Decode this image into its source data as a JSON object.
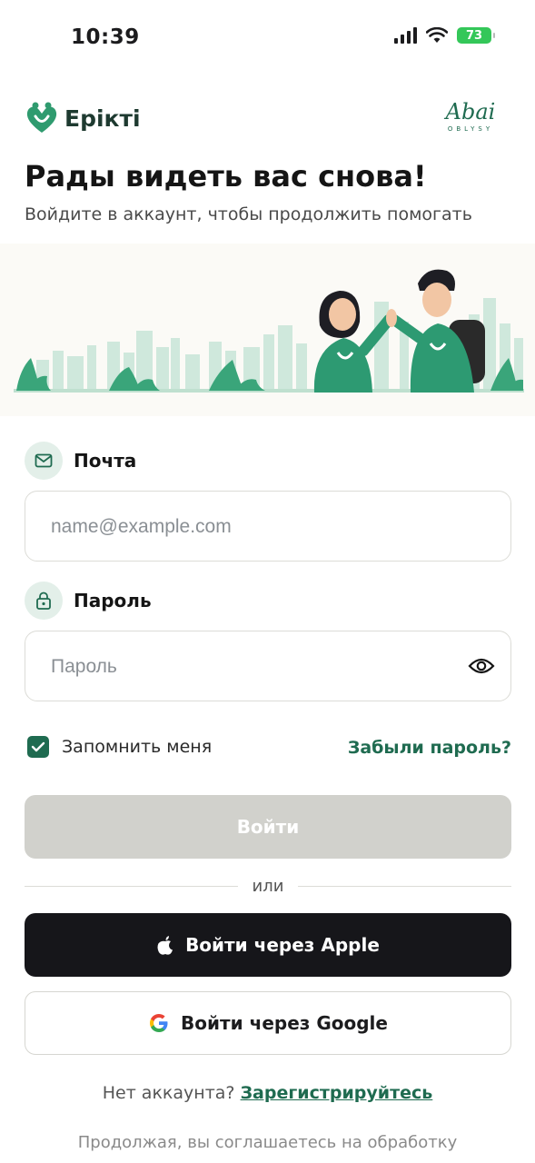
{
  "status_bar": {
    "time": "10:39",
    "battery": "73"
  },
  "header": {
    "app_name": "Ерікті",
    "partner_logo_main": "Abai",
    "partner_logo_sub": "OBLYSY"
  },
  "welcome": {
    "title": "Рады видеть вас снова!",
    "subtitle": "Войдите в аккаунт, чтобы продолжить помогать"
  },
  "form": {
    "email": {
      "label": "Почта",
      "placeholder": "name@example.com",
      "value": "",
      "icon": "mail-icon"
    },
    "password": {
      "label": "Пароль",
      "placeholder": "Пароль",
      "value": "",
      "icon": "lock-icon",
      "toggle_icon": "eye-icon"
    },
    "remember_me": {
      "label": "Запомнить меня",
      "checked": true
    },
    "forgot_password": "Забыли пароль?",
    "login_button": "Войти",
    "divider": "или",
    "apple_button": "Войти через Apple",
    "google_button": "Войти через Google"
  },
  "signup": {
    "prompt": "Нет аккаунта?",
    "link": "Зарегистрируйтесь"
  },
  "legal": {
    "text": "Продолжая, вы соглашаетесь на обработку"
  },
  "colors": {
    "accent": "#1f6b50",
    "login_disabled": "#d1d1cc",
    "apple_bg": "#16161a"
  }
}
